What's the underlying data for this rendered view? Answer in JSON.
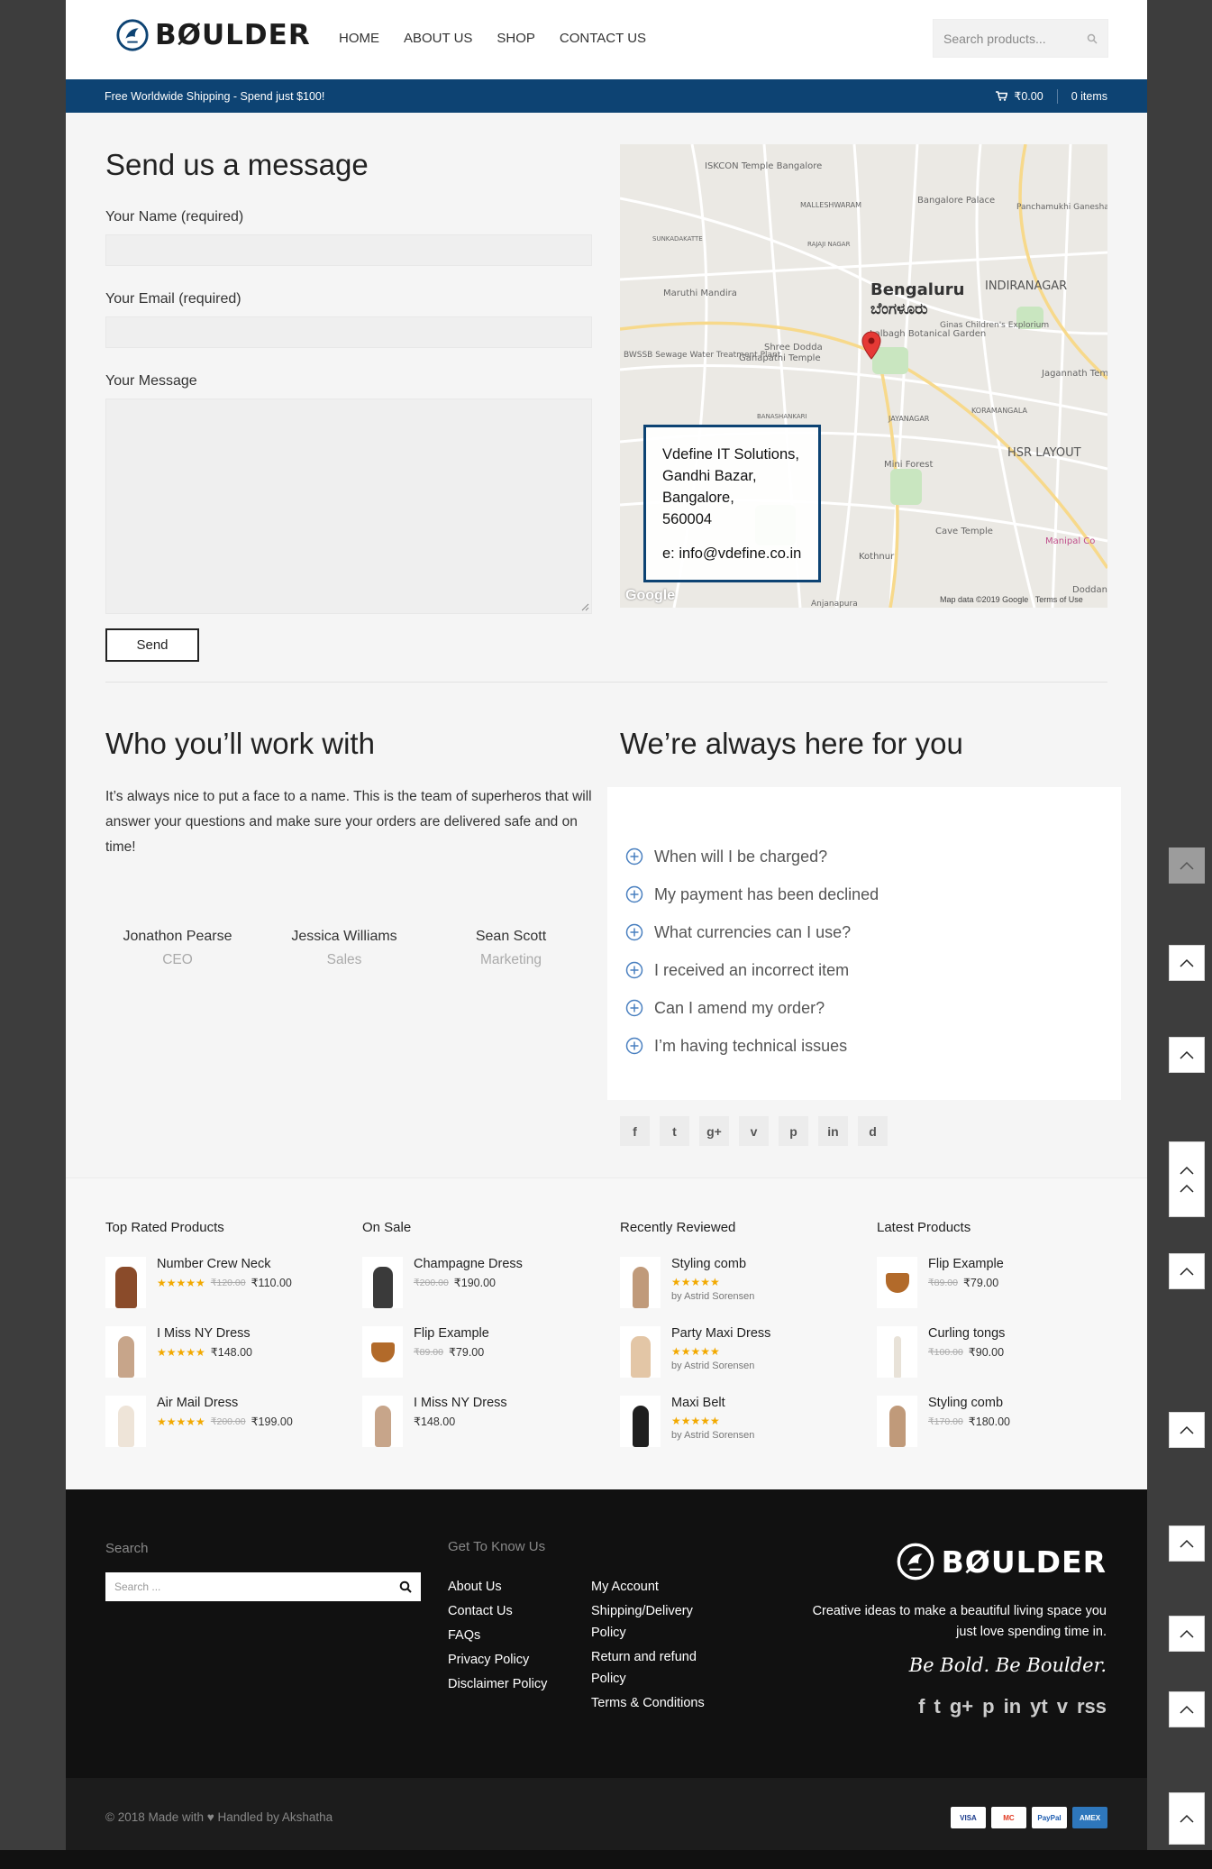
{
  "header": {
    "brand": "BØULDER",
    "nav": [
      "HOME",
      "ABOUT US",
      "SHOP",
      "CONTACT US"
    ],
    "search_placeholder": "Search products..."
  },
  "topbar": {
    "promo": "Free Worldwide Shipping - Spend just $100!",
    "cart_total": "₹0.00",
    "cart_items": "0 items"
  },
  "contact": {
    "title": "Send us a message",
    "name_label": "Your Name (required)",
    "email_label": "Your Email (required)",
    "message_label": "Your Message",
    "send_label": "Send"
  },
  "map": {
    "address_lines": [
      "Vdefine IT Solutions,",
      "Gandhi Bazar,",
      "Bangalore,",
      "560004"
    ],
    "email": "e: info@vdefine.co.in",
    "google": "Google",
    "attribution": "Map data ©2019 Google",
    "terms": "Terms of Use",
    "labels": [
      "Bengaluru",
      "ಬೆಂಗಳೂರು",
      "INDIRANAGAR",
      "HSR LAYOUT",
      "Lalbagh Botanical Garden",
      "Bangalore Palace",
      "ISKCON Temple Bangalore",
      "Mini Forest",
      "Cave Temple",
      "Jagannath Temple",
      "MALLESHWARAM",
      "JAYANAGAR",
      "KORAMANGALA",
      "Maruthi Mandira",
      "BWSSB Sewage Water Treatment Plant",
      "Ganapathi Temple",
      "Panchamukhi Ganesha Temple",
      "Ginas Children's Explorium",
      "Shree Dodda",
      "Kothnur",
      "SUNKADAKATTE",
      "RAJAJI NAGAR",
      "BANASHANKARI",
      "Anjanapura",
      "Doddan",
      "Manipal Co"
    ]
  },
  "team": {
    "title": "Who you’ll work with",
    "text": "It’s always nice to put a face to a name. This is the team of superheros that will answer your questions and make sure your orders are delivered safe and on time!",
    "members": [
      {
        "name": "Jonathon Pearse",
        "role": "CEO"
      },
      {
        "name": "Jessica Williams",
        "role": "Sales"
      },
      {
        "name": "Sean Scott",
        "role": "Marketing"
      }
    ]
  },
  "faq": {
    "title": "We’re always here for you",
    "items": [
      "When will I be charged?",
      "My payment has been declined",
      "What currencies can I use?",
      "I received an incorrect item",
      "Can I amend my order?",
      "I’m having technical issues"
    ]
  },
  "social_share": [
    "f",
    "t",
    "g+",
    "v",
    "p",
    "in",
    "d"
  ],
  "products": {
    "columns": [
      {
        "title": "Top Rated Products",
        "items": [
          {
            "name": "Number Crew Neck",
            "stars": "★★★★★",
            "old": "₹120.00",
            "price": "₹110.00"
          },
          {
            "name": "I Miss NY Dress",
            "stars": "★★★★★",
            "old": "",
            "price": "₹148.00"
          },
          {
            "name": "Air Mail Dress",
            "stars": "★★★★★",
            "old": "₹200.00",
            "price": "₹199.00"
          }
        ]
      },
      {
        "title": "On Sale",
        "items": [
          {
            "name": "Champagne Dress",
            "stars": "",
            "old": "₹200.00",
            "price": "₹190.00"
          },
          {
            "name": "Flip Example",
            "stars": "",
            "old": "₹89.00",
            "price": "₹79.00"
          },
          {
            "name": "I Miss NY Dress",
            "stars": "",
            "old": "",
            "price": "₹148.00"
          }
        ]
      },
      {
        "title": "Recently Reviewed",
        "items": [
          {
            "name": "Styling comb",
            "stars": "★★★★★",
            "by": "by Astrid Sorensen"
          },
          {
            "name": "Party Maxi Dress",
            "stars": "★★★★★",
            "by": "by Astrid Sorensen"
          },
          {
            "name": "Maxi Belt",
            "stars": "★★★★★",
            "by": "by Astrid Sorensen"
          }
        ]
      },
      {
        "title": "Latest Products",
        "items": [
          {
            "name": "Flip Example",
            "stars": "",
            "old": "₹89.00",
            "price": "₹79.00"
          },
          {
            "name": "Curling tongs",
            "stars": "",
            "old": "₹100.00",
            "price": "₹90.00"
          },
          {
            "name": "Styling comb",
            "stars": "",
            "old": "₹170.00",
            "price": "₹180.00"
          }
        ]
      }
    ]
  },
  "footer": {
    "search_label": "Search",
    "search_placeholder": "Search ...",
    "know_title": "Get To Know Us",
    "links_col1": [
      "About Us",
      "Contact Us",
      "FAQs",
      "Privacy Policy",
      "Disclaimer Policy"
    ],
    "links_col2": [
      "My Account",
      "Shipping/Delivery Policy",
      "Return and refund Policy",
      "Terms & Conditions"
    ],
    "brand": "BØULDER",
    "tagline": "Creative ideas to make a beautiful living space you just love spending time in.",
    "motto": "Be Bold. Be Boulder.",
    "social": [
      "f",
      "t",
      "g+",
      "p",
      "in",
      "yt",
      "v",
      "rss"
    ],
    "copyright": "© 2018 Made with ♥ Handled by Akshatha",
    "cards": [
      "VISA",
      "MC",
      "PayPal",
      "AMEX"
    ]
  },
  "colors": {
    "primary": "#0d4373",
    "star": "#f2a900",
    "footer": "#111111"
  }
}
